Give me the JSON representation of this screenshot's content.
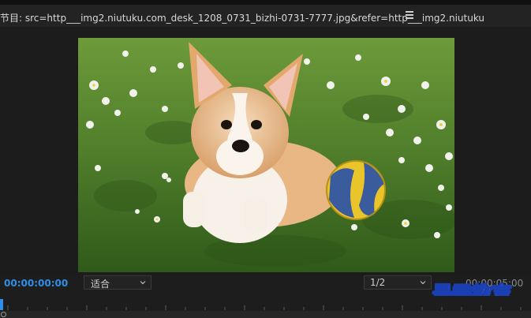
{
  "panel": {
    "title": "节目: src=http___img2.niutuku.com_desk_1208_0731_bizhi-0731-7777.jpg&refer=http___img2.niutuku",
    "menu_icon": "hamburger-menu-icon"
  },
  "viewer": {
    "image_subject": "corgi puppy with ball on grass"
  },
  "controls": {
    "current_timecode": "00:00:00:00",
    "zoom_label": "适合",
    "resolution_label": "1/2",
    "duration_timecode": "00:00:05:00"
  },
  "watermark": {
    "text": "最需教育"
  },
  "colors": {
    "accent_blue": "#2f8ee6",
    "panel_bg": "#1d1d1d",
    "watermark_outline": "#1a3fb3"
  }
}
